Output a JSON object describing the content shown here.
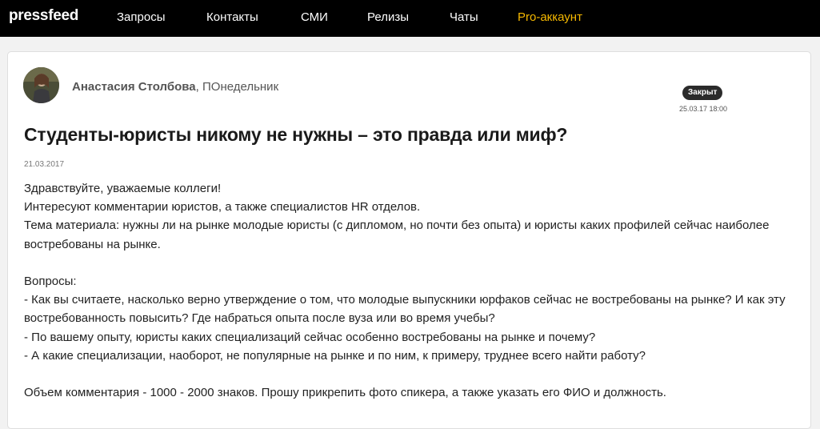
{
  "header": {
    "logo": "pressfeed",
    "nav": [
      {
        "label": "Запросы"
      },
      {
        "label": "Контакты"
      },
      {
        "label": "СМИ"
      },
      {
        "label": "Релизы"
      },
      {
        "label": "Чаты"
      },
      {
        "label": "Pro-аккаунт"
      }
    ]
  },
  "request": {
    "author": "Анастасия Столбова",
    "media": ", ПОнедельник",
    "status": "Закрыт",
    "deadline": "25.03.17 18:00",
    "title": "Студенты-юристы никому не нужны – это правда или миф?",
    "date": "21.03.2017",
    "body": {
      "p1": "Здравствуйте, уважаемые коллеги!",
      "p2": "Интересуют комментарии юристов, а также специалистов HR отделов.",
      "p3": "Тема материала: нужны ли на рынке молодые юристы (с дипломом, но почти без опыта) и юристы каких профилей сейчас наиболее востребованы на рынке.",
      "q_header": "Вопросы:",
      "q1": "- Как вы считаете, насколько верно утверждение о том, что молодые выпускники юрфаков сейчас не востребованы на рынке? И как эту востребованность повысить? Где набраться опыта после вуза или во время учебы?",
      "q2": "- По вашему опыту, юристы каких специализаций сейчас особенно востребованы на рынке и почему?",
      "q3": "- А какие специализации, наоборот, не популярные на рынке и по ним, к примеру, труднее всего найти работу?",
      "footer": "Объем комментария - 1000 - 2000 знаков. Прошу прикрепить фото спикера, а также указать его ФИО и должность."
    }
  }
}
